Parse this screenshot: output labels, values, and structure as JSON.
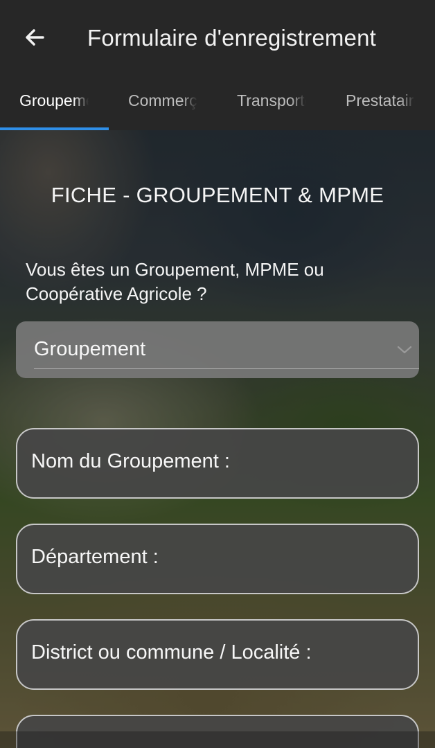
{
  "header": {
    "title": "Formulaire d'enregistrement",
    "back_icon": "arrow-left-icon"
  },
  "tabs": [
    {
      "label": "Groupement",
      "active": true
    },
    {
      "label": "Commerçant",
      "active": false
    },
    {
      "label": "Transporteur",
      "active": false
    },
    {
      "label": "Prestataire",
      "active": false
    }
  ],
  "form": {
    "section_title": "FICHE - GROUPEMENT & MPME",
    "question": "Vous êtes un Groupement, MPME ou Coopérative Agricole ?",
    "select": {
      "value": "Groupement",
      "icon": "chevron-down-icon"
    },
    "fields": [
      {
        "placeholder": "Nom du Groupement :"
      },
      {
        "placeholder": "Département :"
      },
      {
        "placeholder": "District ou commune / Localité :"
      },
      {
        "placeholder": ""
      }
    ]
  },
  "colors": {
    "appbar": "#272727",
    "tab_indicator": "#2f8fe8",
    "field_bg": "#464646",
    "field_border": "#c7c7c7"
  }
}
